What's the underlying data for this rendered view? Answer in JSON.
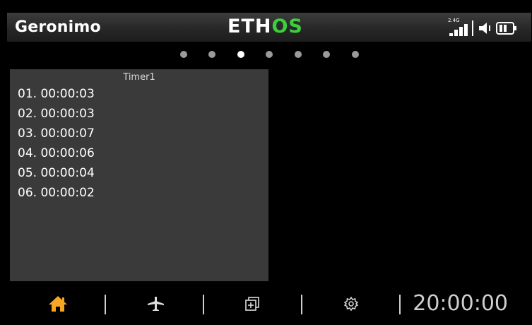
{
  "header": {
    "model_name": "Geronimo",
    "logo_left": "ETH",
    "logo_right": "OS",
    "rf_label": "2.4G"
  },
  "pager": {
    "count": 7,
    "active_index": 2
  },
  "panel": {
    "title": "Timer1",
    "laps": [
      "01. 00:00:03",
      "02. 00:00:03",
      "03. 00:00:07",
      "04. 00:00:06",
      "05. 00:00:04",
      "06. 00:00:02"
    ]
  },
  "footer": {
    "clock": "20:00:00",
    "icons": [
      "home-icon",
      "airplane-icon",
      "system-icon",
      "settings-icon"
    ]
  },
  "colors": {
    "accent": "#f5a623",
    "logo_green": "#3cd13c",
    "panel_bg": "#3a3a3a"
  }
}
